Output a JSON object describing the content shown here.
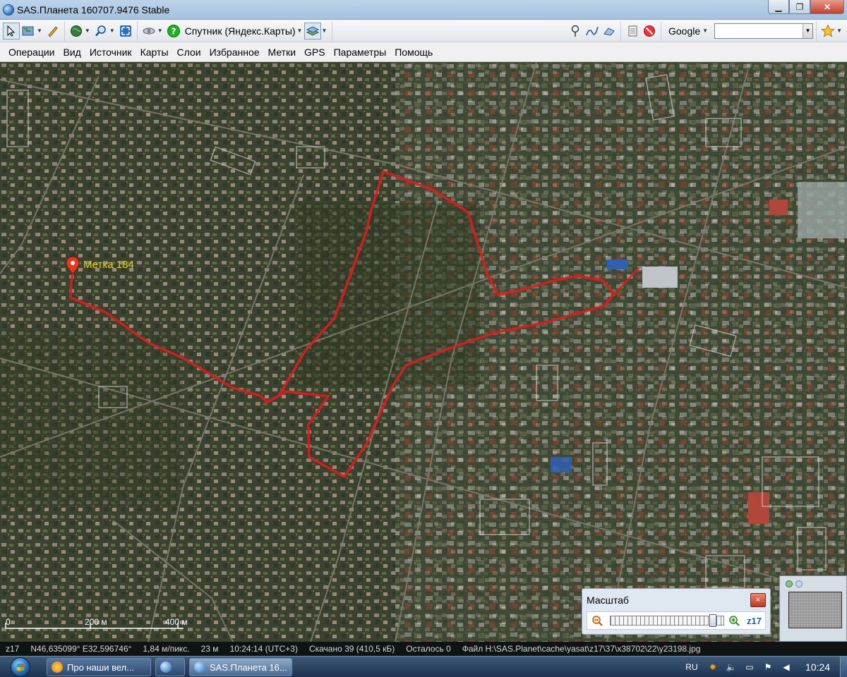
{
  "window": {
    "title": "SAS.Планета 160707.9476 Stable"
  },
  "toolbar": {
    "map_source_label": "Спутник (Яндекс.Карты)",
    "search_engine": "Google",
    "search_value": ""
  },
  "menu": {
    "items": [
      "Операции",
      "Вид",
      "Источник",
      "Карты",
      "Слои",
      "Избранное",
      "Метки",
      "GPS",
      "Параметры",
      "Помощь"
    ]
  },
  "map": {
    "placemark_label": "Метка 184",
    "scale_labels": [
      "0",
      "200 м",
      "400 м"
    ],
    "track_color": "#d81d1d",
    "label_color": "#e5d11c"
  },
  "scale_window": {
    "title": "Масштаб",
    "close_glyph": "×",
    "zoom_label": "z17",
    "zoom_level": 17
  },
  "status": {
    "zoom": "z17",
    "coords": "N46,635099° E32,596746°",
    "resolution": "1,84 м/пикс.",
    "elevation": "23 м",
    "time": "10:24:14 (UTC+3)",
    "downloaded": "Скачано 39 (410,5 кБ)",
    "remaining": "Осталось 0",
    "file": "Файл H:\\SAS.Planet\\cache\\yasat\\z17\\37\\x38702\\22\\y23198.jpg"
  },
  "taskbar": {
    "tasks": [
      {
        "label": "Про наши вел...",
        "active": false
      },
      {
        "label": "",
        "active": false
      },
      {
        "label": "SAS.Планета 16...",
        "active": true
      }
    ],
    "language": "RU",
    "clock": "10:24"
  }
}
